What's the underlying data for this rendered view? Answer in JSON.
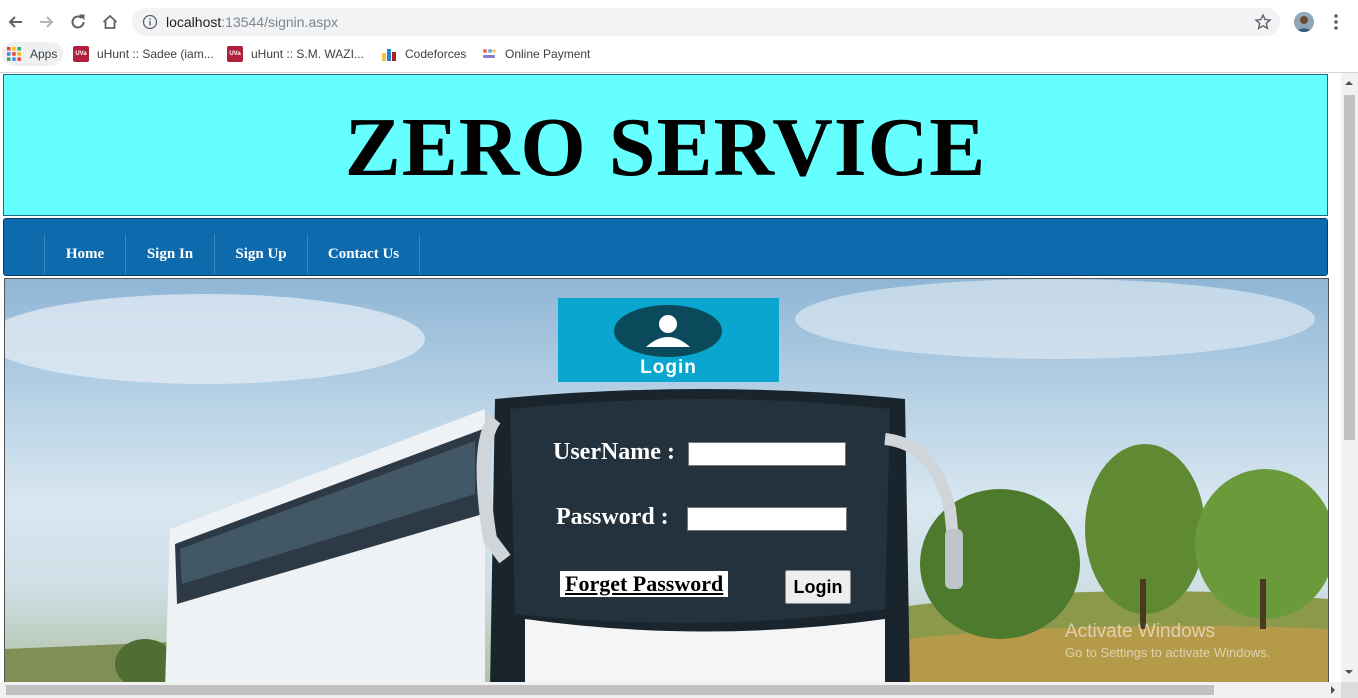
{
  "browser": {
    "url_host": "localhost",
    "url_path": ":13544/signin.aspx",
    "bookmarks": [
      {
        "label": "Apps",
        "icon": "apps-grid-icon"
      },
      {
        "label": "uHunt :: Sadee (iam...",
        "icon": "uva-icon"
      },
      {
        "label": "uHunt :: S.M. WAZI...",
        "icon": "uva-icon"
      },
      {
        "label": "Codeforces",
        "icon": "codeforces-icon"
      },
      {
        "label": "Online Payment",
        "icon": "payment-icon"
      }
    ]
  },
  "header": {
    "title": "ZERO SERVICE"
  },
  "nav": {
    "items": [
      {
        "label": "Home"
      },
      {
        "label": "Sign In"
      },
      {
        "label": "Sign Up"
      },
      {
        "label": "Contact Us"
      }
    ]
  },
  "login": {
    "logo_text": "Login",
    "username_label": "UserName :",
    "username_value": "",
    "password_label": "Password :",
    "password_value": "",
    "forget_link": " Forget Password ",
    "submit_label": "Login"
  },
  "watermark": {
    "line1": "Activate Windows",
    "line2": "Go to Settings to activate Windows."
  },
  "colors": {
    "header_bg": "#66ffff",
    "nav_bg": "#0d6aad",
    "logo_bg": "#0aa6cf"
  }
}
